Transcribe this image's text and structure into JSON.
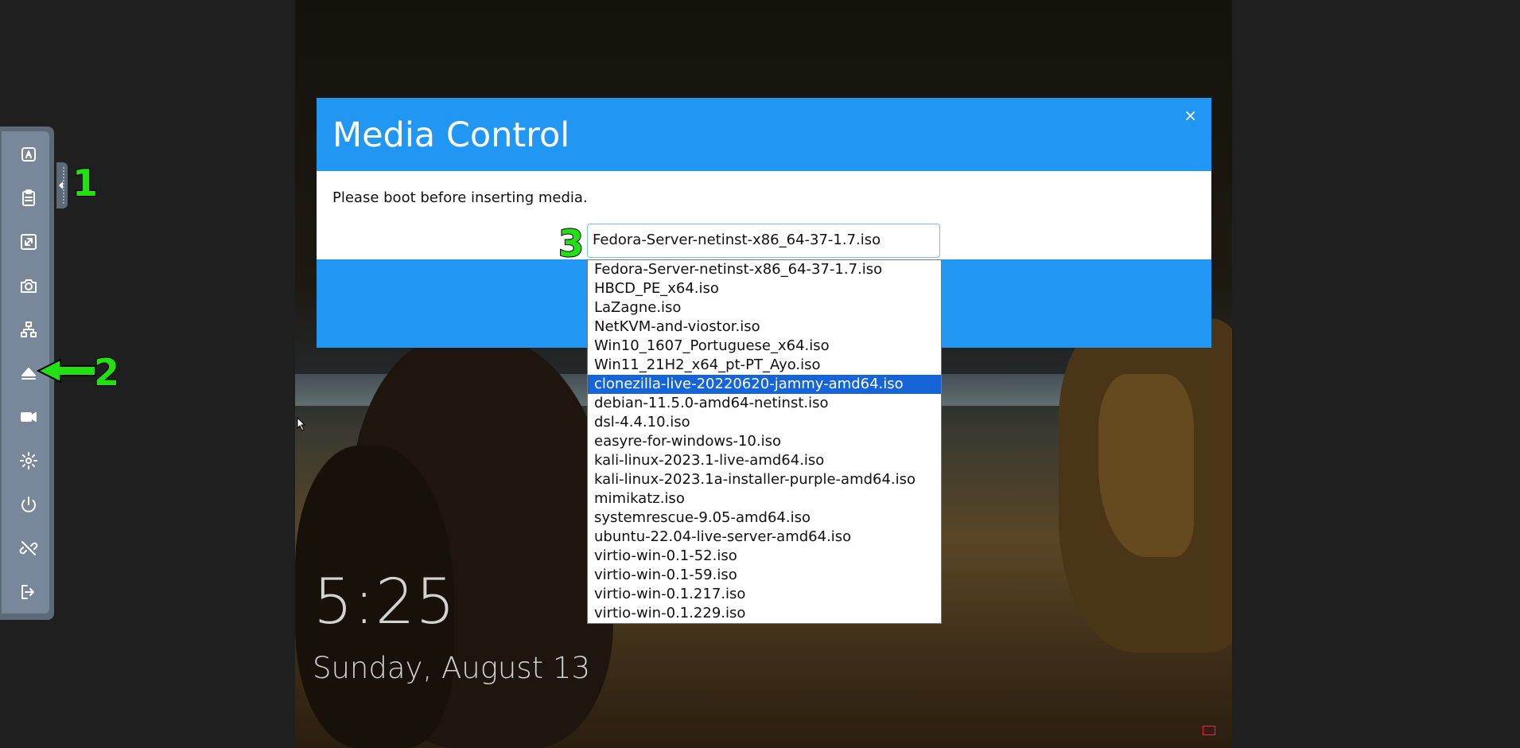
{
  "toolbar": {
    "items": [
      {
        "name": "keyboard-icon"
      },
      {
        "name": "clipboard-icon"
      },
      {
        "name": "fullscreen-icon"
      },
      {
        "name": "camera-icon"
      },
      {
        "name": "network-icon"
      },
      {
        "name": "eject-media-icon"
      },
      {
        "name": "video-record-icon"
      },
      {
        "name": "gear-icon"
      },
      {
        "name": "power-icon"
      },
      {
        "name": "disconnect-icon"
      },
      {
        "name": "logout-icon"
      }
    ]
  },
  "annotations": {
    "one": "1",
    "two": "2",
    "three": "3",
    "color": "#22e012"
  },
  "lockscreen": {
    "time": "5:25",
    "date": "Sunday, August 13"
  },
  "modal": {
    "title": "Media Control",
    "close_label": "×",
    "message": "Please boot before inserting media.",
    "header_color": "#2196f3"
  },
  "media_select": {
    "value": "Fedora-Server-netinst-x86_64-37-1.7.iso",
    "highlighted": "clonezilla-live-20220620-jammy-amd64.iso",
    "options": [
      "Fedora-Server-netinst-x86_64-37-1.7.iso",
      "HBCD_PE_x64.iso",
      "LaZagne.iso",
      "NetKVM-and-viostor.iso",
      "Win10_1607_Portuguese_x64.iso",
      "Win11_21H2_x64_pt-PT_Ayo.iso",
      "clonezilla-live-20220620-jammy-amd64.iso",
      "debian-11.5.0-amd64-netinst.iso",
      "dsl-4.4.10.iso",
      "easyre-for-windows-10.iso",
      "kali-linux-2023.1-live-amd64.iso",
      "kali-linux-2023.1a-installer-purple-amd64.iso",
      "mimikatz.iso",
      "systemrescue-9.05-amd64.iso",
      "ubuntu-22.04-live-server-amd64.iso",
      "virtio-win-0.1-52.iso",
      "virtio-win-0.1-59.iso",
      "virtio-win-0.1.217.iso",
      "virtio-win-0.1.229.iso"
    ]
  }
}
